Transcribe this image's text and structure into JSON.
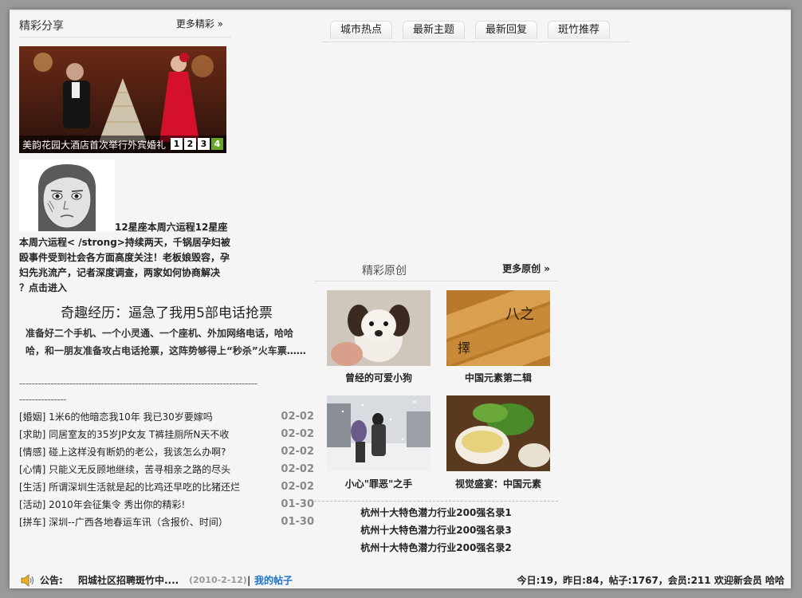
{
  "share": {
    "title": "精彩分享",
    "more": "更多精彩 »"
  },
  "slideshow": {
    "caption": "美韵花园大酒店首次举行外宾婚礼",
    "pages": [
      "1",
      "2",
      "3",
      "4"
    ],
    "active_page": "4"
  },
  "horoscope": {
    "text": "12星座本周六运程12星座本周六运程< /strong>持续两天，千锅居孕妇被殴事件受到社会各方面高度关注！老板娘毁容，孕妇先兆流产，记者深度调查，两家如何协商解决 ？点击进入"
  },
  "experience": {
    "title": "奇趣经历：逼急了我用5部电话抢票",
    "body": "准备好二个手机、一个小灵通、一个座机、外加网络电话，哈哈哈，和一朋友准备攻占电话抢票，这阵势够得上“秒杀”火车票……",
    "dashes": "----------------------------------------------------------------------------",
    "dashes2": "---------------"
  },
  "news": [
    {
      "text": "[婚姻] 1米6的他暗恋我10年 我已30岁要嫁吗",
      "date": "02-02"
    },
    {
      "text": "[求助] 同居室友的35岁JP女友 T裤挂厕所N天不收",
      "date": "02-02"
    },
    {
      "text": "[情感] 碰上这样没有断奶的老公，我该怎么办啊?",
      "date": "02-02"
    },
    {
      "text": "[心情] 只能义无反顾地继续，苦寻相亲之路的尽头",
      "date": "02-02"
    },
    {
      "text": "[生活] 所谓深圳生活就是起的比鸡还早吃的比猪还烂",
      "date": "02-02"
    },
    {
      "text": "[活动] 2010年会征集令 秀出你的精彩!",
      "date": "01-30"
    },
    {
      "text": "[拼车] 深圳--广西各地春运车讯（含报价、时间）",
      "date": "01-30"
    }
  ],
  "tabs": [
    "城市热点",
    "最新主题",
    "最新回复",
    "斑竹推荐"
  ],
  "original": {
    "title": "精彩原创",
    "more": "更多原创 »",
    "items": [
      {
        "caption": "曾经的可爱小狗"
      },
      {
        "caption": "中国元素第二辑"
      },
      {
        "caption": "小心\"罪恶\"之手"
      },
      {
        "caption": "视觉盛宴：中国元素"
      }
    ]
  },
  "rankings": [
    "杭州十大特色潜力行业200强名录1",
    "杭州十大特色潜力行业200强名录3",
    "杭州十大特色潜力行业200强名录2"
  ],
  "footer": {
    "notice_label": "公告:",
    "notice_link": "阳城社区招聘斑竹中....",
    "notice_date": "(2010-2-12)",
    "separator": "|",
    "my_posts": "我的帖子",
    "stats": "今日:19，昨日:84，帖子:1767，会员:211 欢迎新会员 哈哈"
  },
  "colors": {
    "link_blue": "#1a73c9",
    "active_green": "#6aa52a"
  }
}
